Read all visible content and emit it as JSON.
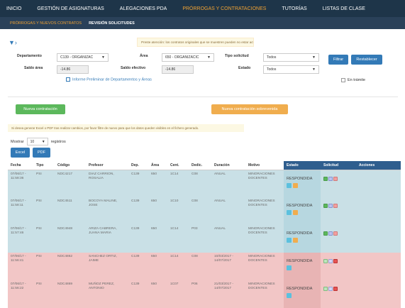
{
  "topnav": [
    "INICIO",
    "GESTIÓN DE ASIGNATURAS",
    "ALEGACIONES PDA",
    "PRÓRROGAS Y CONTRATACIONES",
    "TUTORÍAS",
    "LISTAS DE CLASE"
  ],
  "subnav": [
    "PRÓRROGAS Y NUEVOS CONTRATOS",
    "REVISIÓN SOLICITUDES"
  ],
  "notice": "Preste atención: los contratos originales que se muestren pueden no estar actualizados en el intervalo de 1 día",
  "filters": {
    "departamento_label": "Departamento",
    "departamento_value": "C139 - ORGANIZAC",
    "area_label": "Área",
    "area_value": "650 - ORGANIZACIC",
    "tipo_label": "Tipo solicitud",
    "tipo_value": "Todos",
    "saldo_area_label": "Saldo área",
    "saldo_area_value": "-14.86",
    "saldo_efectivo_label": "Saldo efectivo",
    "saldo_efectivo_value": "-14.86",
    "estado_label": "Estado",
    "estado_value": "Todos",
    "filtrar": "Filtrar",
    "restablecer": "Restablecer",
    "informe": "Informe Preliminar de Departamentos y Áreas",
    "en_tramite": "En trámite"
  },
  "buttons": {
    "nueva": "Nueva contratación",
    "sobrevenida": "Nueva contratación sobrevenida",
    "excel": "Excel",
    "pdf": "PDF"
  },
  "warning": "Si desea generar Excel o PDF tras realizar cambios, por favor filtre de nuevo para que los datos queden visibles en el fichero generado.",
  "mostrar": {
    "pre": "Mostrar",
    "value": "10",
    "post": "registros"
  },
  "columns": [
    "Fecha",
    "Tipo",
    "Código",
    "Profesor",
    "Dep.",
    "Área",
    "Cent.",
    "Dedic.",
    "Duración",
    "Motivo",
    "Estado",
    "Solicitud",
    "Acciones"
  ],
  "rows": [
    {
      "fecha": "07/06/17 - 11:58:36",
      "tipo": "PSI",
      "codigo": "NDC4217",
      "profesor": "DIAZ CARRION, ROSALIA",
      "dep": "C139",
      "area": "650",
      "cent": "1C14",
      "dedic": "C08",
      "duracion": "ANUAL",
      "motivo": "MINORACIONES DOCENTES",
      "estado": "RESPONDIDA",
      "color": "b",
      "orange": true
    },
    {
      "fecha": "07/06/17 - 11:58:11",
      "tipo": "PSI",
      "codigo": "NDC4511",
      "profesor": "BOCOYA MALINE, JOSE",
      "dep": "C139",
      "area": "650",
      "cent": "1C10",
      "dedic": "C08",
      "duracion": "ANUAL",
      "motivo": "MINORACIONES DOCENTES",
      "estado": "RESPONDIDA",
      "color": "b",
      "orange": true
    },
    {
      "fecha": "07/06/17 - 11:57:46",
      "tipo": "PSI",
      "codigo": "NDC4948",
      "profesor": "ARIZA CABRERA, JUANA MARIA",
      "dep": "C139",
      "area": "650",
      "cent": "1C14",
      "dedic": "P03",
      "duracion": "ANUAL",
      "motivo": "MINORACIONES DOCENTES",
      "estado": "RESPONDIDA",
      "color": "b",
      "orange": true
    },
    {
      "fecha": "07/06/17 - 11:56:41",
      "tipo": "PSI",
      "codigo": "NDC4862",
      "profesor": "SANCHEZ ORTIZ, JAIME",
      "dep": "C139",
      "area": "650",
      "cent": "1C14",
      "dedic": "C08",
      "duracion": "10/03/2017 - 14/07/2017",
      "motivo": "MINORACIONES DOCENTES",
      "estado": "RESPONDIDA",
      "color": "r",
      "orange": false
    },
    {
      "fecha": "07/06/17 - 11:56:22",
      "tipo": "PSI",
      "codigo": "NDC4869",
      "profesor": "MUÑOZ PEREZ, ANTONIO",
      "dep": "C139",
      "area": "650",
      "cent": "1C07",
      "dedic": "P06",
      "duracion": "21/03/2017 - 14/07/2017",
      "motivo": "MINORACIONES DOCENTES",
      "estado": "RESPONDIDA",
      "color": "r",
      "orange": false
    }
  ]
}
